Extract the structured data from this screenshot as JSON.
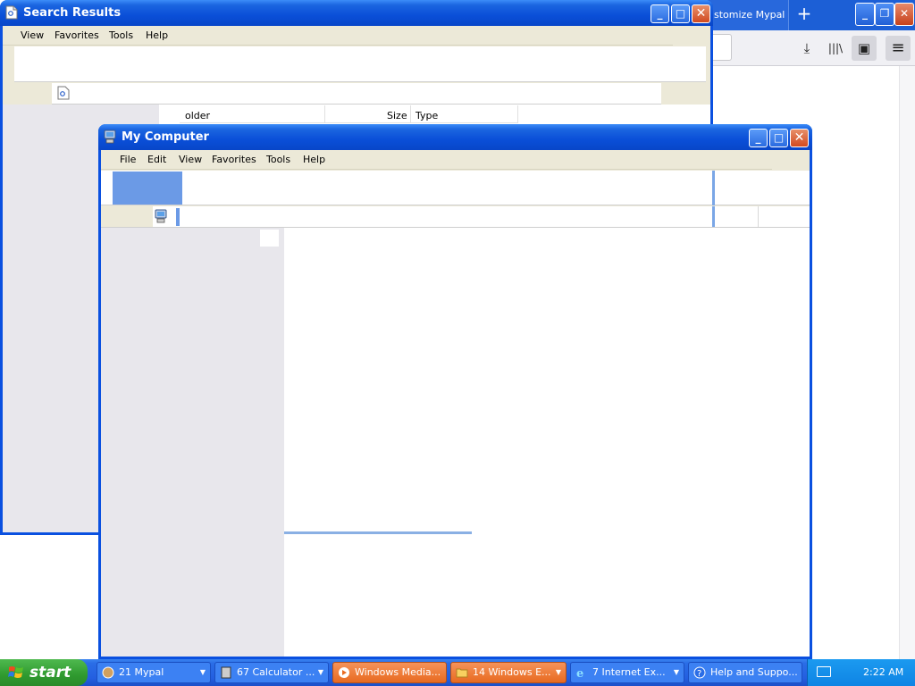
{
  "mypal": {
    "tab_label": "stomize Mypal",
    "new_tab": "+",
    "minimize": "_",
    "restore": "❐",
    "close": "✕",
    "tool_download": "⤓",
    "tool_library": "|||\\",
    "tool_sidebar": "▣",
    "tool_menu": "≡"
  },
  "search_window": {
    "title": "Search Results",
    "menu": [
      "View",
      "Favorites",
      "Tools",
      "Help"
    ],
    "columns": [
      "older",
      "Size",
      "Type"
    ],
    "minimize": "_",
    "maximize": "□",
    "close": "✕"
  },
  "mycomputer_window": {
    "title": "My Computer",
    "menu": [
      "File",
      "Edit",
      "View",
      "Favorites",
      "Tools",
      "Help"
    ],
    "minimize": "_",
    "maximize": "□",
    "close": "✕"
  },
  "taskbar": {
    "start_label": "start",
    "tasks": [
      {
        "label": "21 Mypal"
      },
      {
        "label": "67 Calculator ..."
      },
      {
        "label": "Windows Media..."
      },
      {
        "label": "14 Windows E..."
      },
      {
        "label": "7 Internet Ex..."
      },
      {
        "label": "Help and Suppo..."
      }
    ],
    "clock": "2:22 AM"
  },
  "colors": {
    "xp_title": "#0a4fd8",
    "taskbar": "#245fe0",
    "start": "#2f9a2f",
    "orange_task": "#e86a20",
    "selection": "#6b9ae6"
  }
}
